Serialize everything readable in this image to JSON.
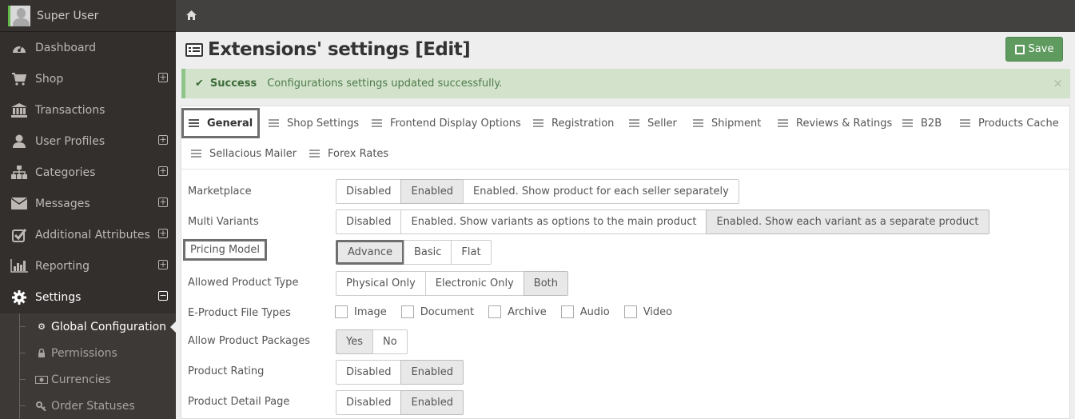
{
  "sidebar": {
    "user_name": "Super User",
    "items": [
      {
        "label": "Dashboard",
        "icon": "dashboard-icon",
        "expandable": false
      },
      {
        "label": "Shop",
        "icon": "cart-icon",
        "expandable": true
      },
      {
        "label": "Transactions",
        "icon": "bank-icon",
        "expandable": false
      },
      {
        "label": "User Profiles",
        "icon": "user-icon",
        "expandable": true
      },
      {
        "label": "Categories",
        "icon": "sitemap-icon",
        "expandable": true
      },
      {
        "label": "Messages",
        "icon": "envelope-icon",
        "expandable": true
      },
      {
        "label": "Additional Attributes",
        "icon": "checkbox-icon",
        "expandable": true
      },
      {
        "label": "Reporting",
        "icon": "bar-chart-icon",
        "expandable": true
      },
      {
        "label": "Settings",
        "icon": "gear-icon",
        "expandable": true,
        "expanded": true
      }
    ],
    "expand_symbol": "+",
    "collapse_symbol": "−",
    "submenu": [
      {
        "label": "Global Configuration",
        "icon": "gears-icon",
        "active": true
      },
      {
        "label": "Permissions",
        "icon": "lock-icon"
      },
      {
        "label": "Currencies",
        "icon": "money-icon"
      },
      {
        "label": "Order Statuses",
        "icon": "key-icon"
      }
    ]
  },
  "topbar": {
    "home_icon": "home-icon"
  },
  "header": {
    "title": "Extensions' settings [Edit]",
    "save_label": "Save"
  },
  "alert": {
    "type": "success",
    "heading": "Success",
    "message": "Configurations settings updated successfully.",
    "close_symbol": "×"
  },
  "tabs": [
    {
      "label": "General",
      "active": true
    },
    {
      "label": "Shop Settings"
    },
    {
      "label": "Frontend Display Options"
    },
    {
      "label": "Registration"
    },
    {
      "label": "Seller"
    },
    {
      "label": "Shipment"
    },
    {
      "label": "Reviews & Ratings"
    },
    {
      "label": "B2B"
    },
    {
      "label": "Products Cache"
    },
    {
      "label": "Sellacious Mailer"
    },
    {
      "label": "Forex Rates"
    }
  ],
  "form": {
    "marketplace": {
      "label": "Marketplace",
      "options": [
        "Disabled",
        "Enabled",
        "Enabled. Show product for each seller separately"
      ],
      "selected": "Enabled"
    },
    "multi_variants": {
      "label": "Multi Variants",
      "options": [
        "Disabled",
        "Enabled. Show variants as options to the main product",
        "Enabled. Show each variant as a separate product"
      ],
      "selected": "Enabled. Show each variant as a separate product"
    },
    "pricing_model": {
      "label": "Pricing Model",
      "options": [
        "Advance",
        "Basic",
        "Flat"
      ],
      "selected": "Advance"
    },
    "allowed_product_type": {
      "label": "Allowed Product Type",
      "options": [
        "Physical Only",
        "Electronic Only",
        "Both"
      ],
      "selected": "Both"
    },
    "e_product_file_types": {
      "label": "E-Product File Types",
      "options": [
        {
          "label": "Image",
          "checked": false
        },
        {
          "label": "Document",
          "checked": false
        },
        {
          "label": "Archive",
          "checked": false
        },
        {
          "label": "Audio",
          "checked": false
        },
        {
          "label": "Video",
          "checked": false
        }
      ]
    },
    "allow_product_packages": {
      "label": "Allow Product Packages",
      "options": [
        "Yes",
        "No"
      ],
      "selected": "Yes"
    },
    "product_rating": {
      "label": "Product Rating",
      "options": [
        "Disabled",
        "Enabled"
      ],
      "selected": "Enabled"
    },
    "product_detail_page": {
      "label": "Product Detail Page",
      "options": [
        "Disabled",
        "Enabled"
      ],
      "selected": "Enabled"
    }
  }
}
